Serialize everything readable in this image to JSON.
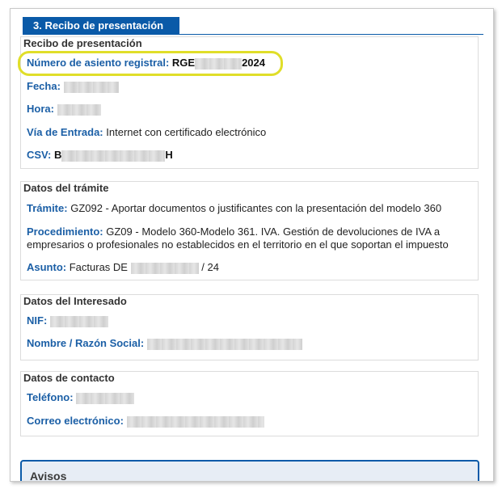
{
  "tab": {
    "title": "3. Recibo de presentación"
  },
  "recibo": {
    "section_title": "Recibo de presentación",
    "numero_label": "Número de asiento registral:",
    "numero_prefix": "RGE",
    "numero_suffix": "2024",
    "fecha_label": "Fecha:",
    "hora_label": "Hora:",
    "via_label": "Vía de Entrada:",
    "via_value": "Internet con certificado electrónico",
    "csv_label": "CSV:",
    "csv_prefix": "B",
    "csv_suffix": "H"
  },
  "tramite": {
    "section_title": "Datos del trámite",
    "tramite_label": "Trámite:",
    "tramite_value": "GZ092 - Aportar documentos o justificantes con la presentación del modelo 360",
    "procedimiento_label": "Procedimiento:",
    "procedimiento_value_line1": "GZ09 - Modelo 360-Modelo 361. IVA. Gestión de devoluciones de IVA a",
    "procedimiento_value_line2": "empresarios o profesionales no establecidos en el territorio en el que soportan el impuesto",
    "asunto_label": "Asunto:",
    "asunto_prefix": "Facturas DE",
    "asunto_suffix": "/ 24"
  },
  "interesado": {
    "section_title": "Datos del Interesado",
    "nif_label": "NIF:",
    "nombre_label": "Nombre / Razón Social:"
  },
  "contacto": {
    "section_title": "Datos de contacto",
    "telefono_label": "Teléfono:",
    "correo_label": "Correo electrónico:"
  },
  "avisos": {
    "title": "Avisos"
  },
  "colors": {
    "accent": "#0a5aa8",
    "label": "#1b5fa6",
    "highlight": "#e0de29"
  }
}
